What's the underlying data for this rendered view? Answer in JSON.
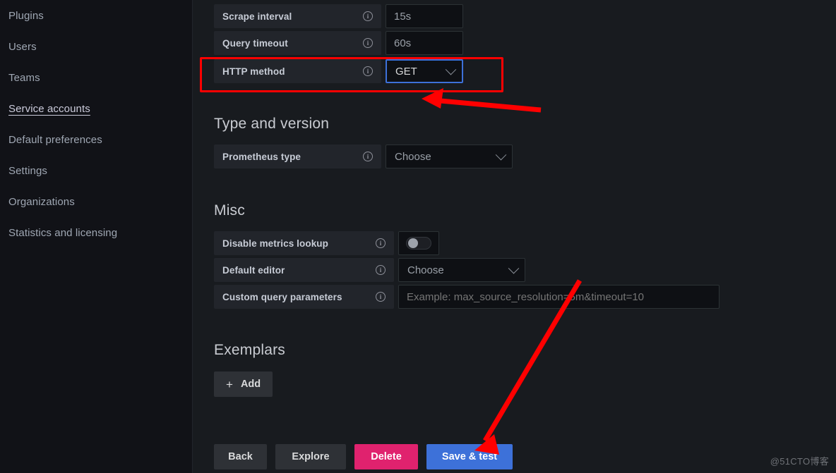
{
  "sidebar": {
    "items": [
      {
        "label": "Plugins",
        "active": false
      },
      {
        "label": "Users",
        "active": false
      },
      {
        "label": "Teams",
        "active": false
      },
      {
        "label": "Service accounts",
        "active": true
      },
      {
        "label": "Default preferences",
        "active": false
      },
      {
        "label": "Settings",
        "active": false
      },
      {
        "label": "Organizations",
        "active": false
      },
      {
        "label": "Statistics and licensing",
        "active": false
      }
    ]
  },
  "top_fields": {
    "scrape_interval": {
      "label": "Scrape interval",
      "value": "15s",
      "info_icon": "info-circle-icon"
    },
    "query_timeout": {
      "label": "Query timeout",
      "value": "60s",
      "info_icon": "info-circle-icon"
    },
    "http_method": {
      "label": "HTTP method",
      "value": "GET",
      "info_icon": "info-circle-icon",
      "chevron_icon": "chevron-down-icon"
    }
  },
  "type_and_version": {
    "heading": "Type and version",
    "prometheus_type": {
      "label": "Prometheus type",
      "value": "Choose",
      "info_icon": "info-circle-icon",
      "chevron_icon": "chevron-down-icon"
    }
  },
  "misc": {
    "heading": "Misc",
    "disable_metrics_lookup": {
      "label": "Disable metrics lookup",
      "info_icon": "info-circle-icon",
      "state": "off"
    },
    "default_editor": {
      "label": "Default editor",
      "value": "Choose",
      "info_icon": "info-circle-icon",
      "chevron_icon": "chevron-down-icon"
    },
    "custom_query_parameters": {
      "label": "Custom query parameters",
      "placeholder": "Example: max_source_resolution=5m&timeout=10",
      "value": "",
      "info_icon": "info-circle-icon"
    }
  },
  "exemplars": {
    "heading": "Exemplars",
    "add_button": {
      "label": "Add",
      "icon": "plus-icon"
    }
  },
  "footer": {
    "back": "Back",
    "explore": "Explore",
    "delete": "Delete",
    "save_and_test": "Save & test"
  },
  "annotations": {
    "highlight_color": "#ff0000",
    "focus_color": "#3d71d9"
  },
  "watermark": "@51CTO博客"
}
